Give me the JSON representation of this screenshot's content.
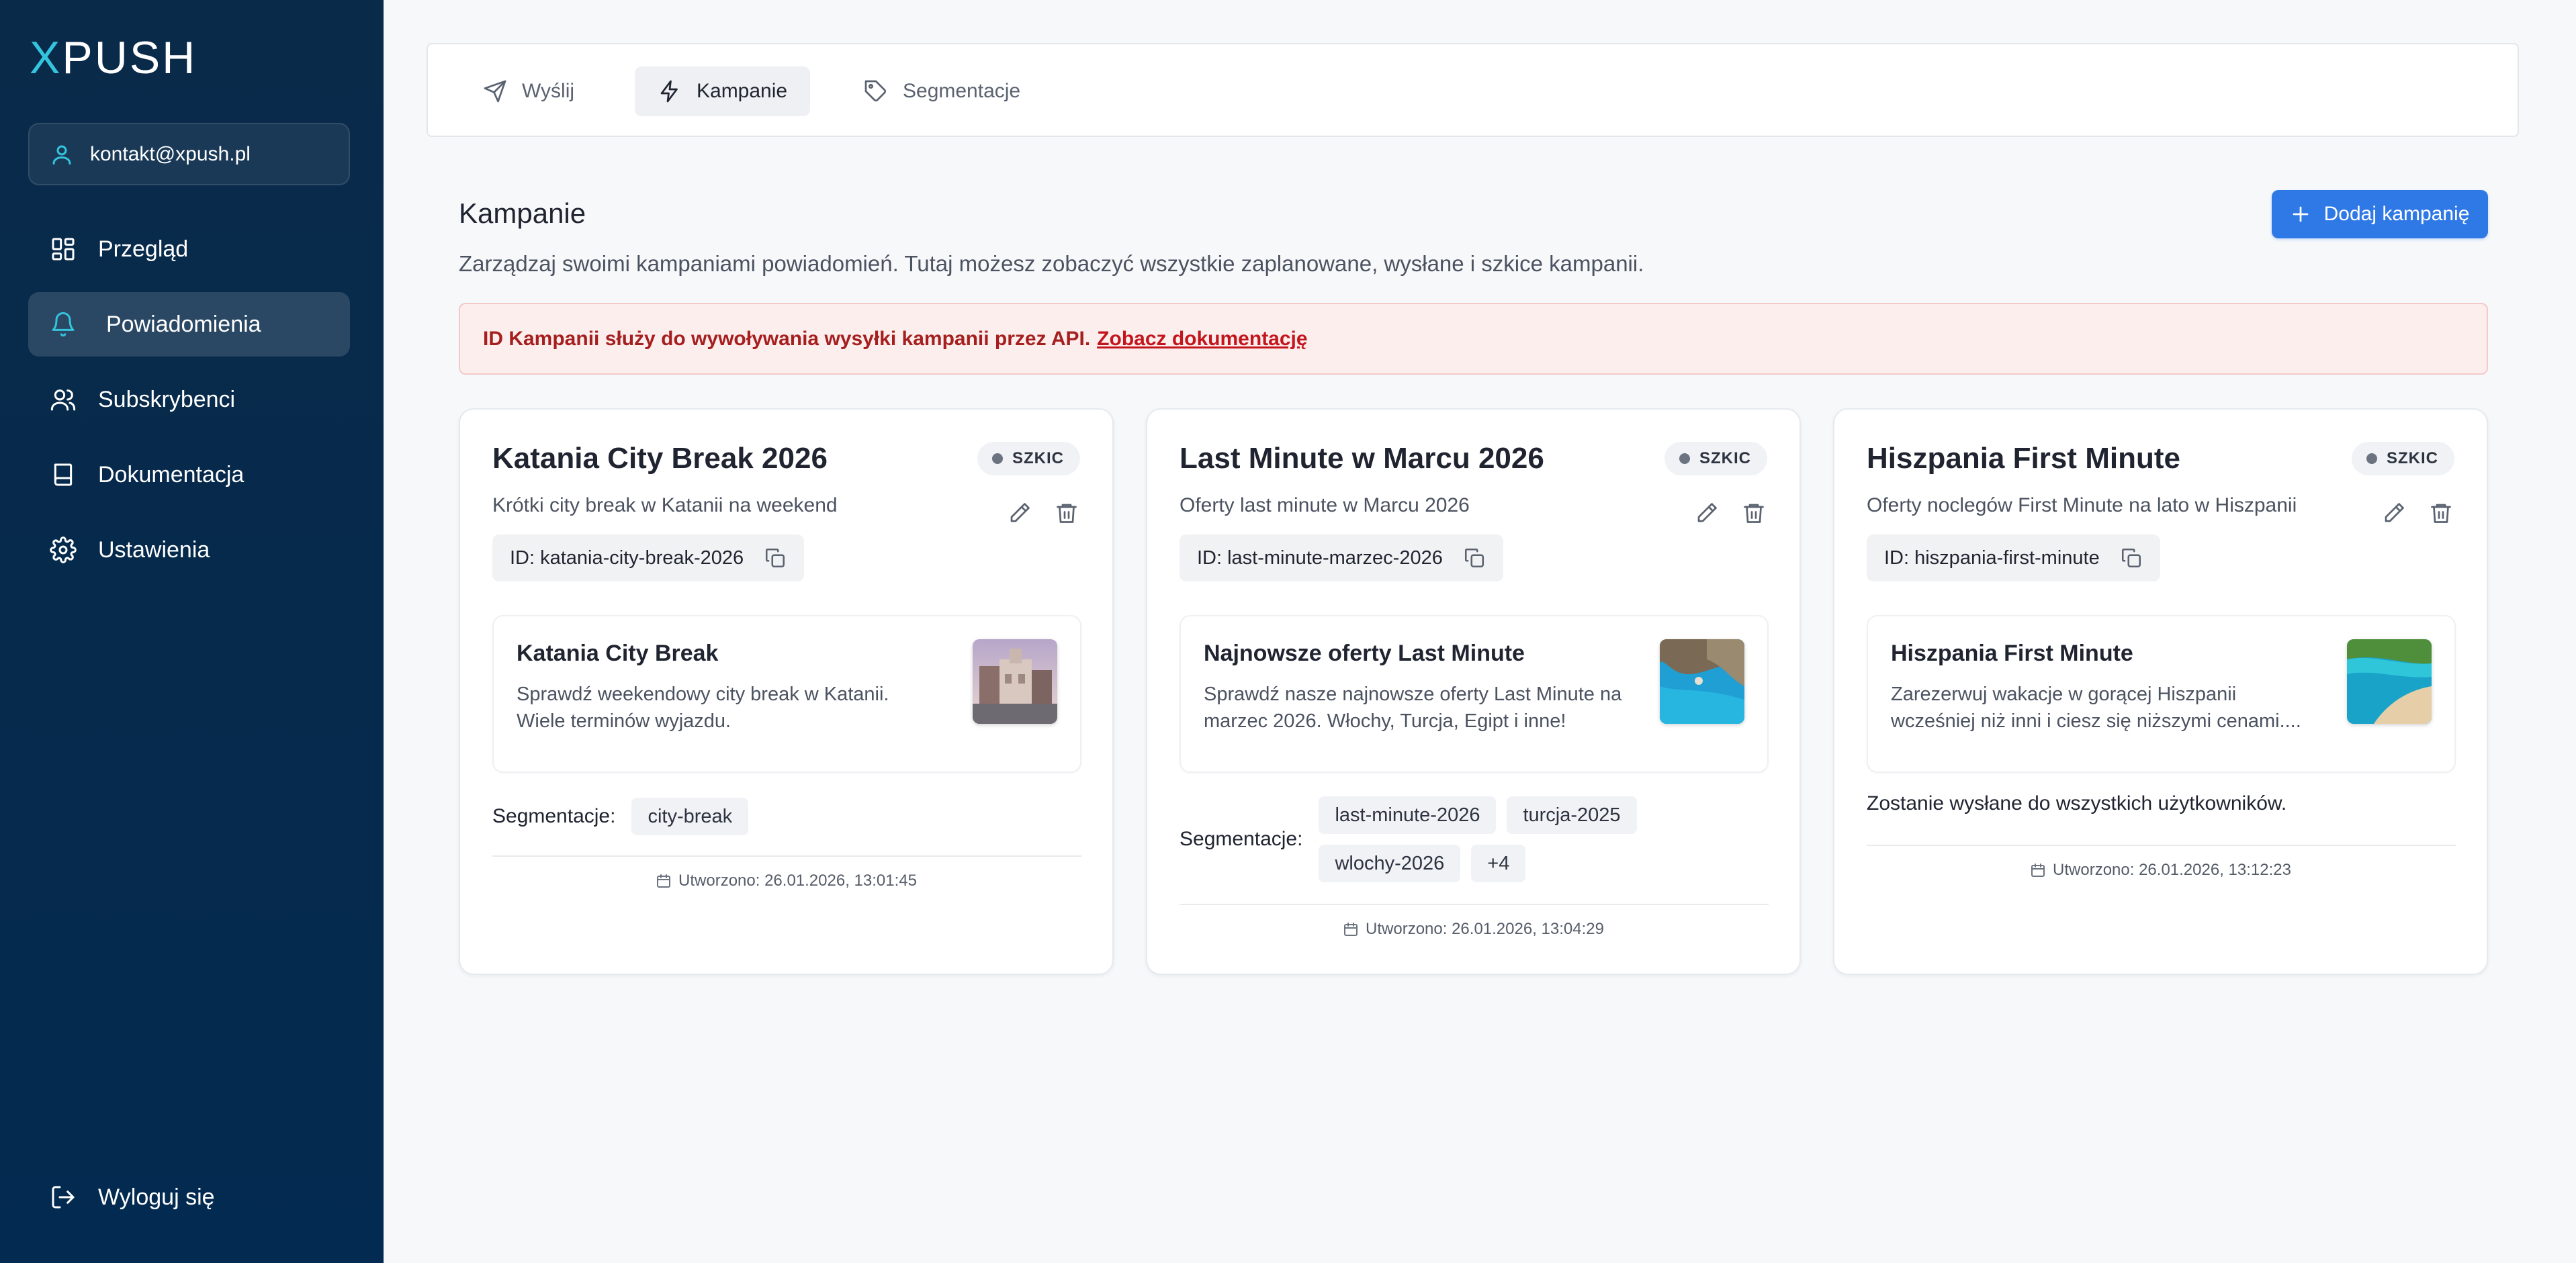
{
  "app": {
    "logo_x": "X",
    "logo_rest": "PUSH"
  },
  "sidebar": {
    "account_email": "kontakt@xpush.pl",
    "items": [
      {
        "label": "Przegląd",
        "icon": "grid-icon"
      },
      {
        "label": "Powiadomienia",
        "icon": "bell-icon",
        "active": true
      },
      {
        "label": "Subskrybenci",
        "icon": "users-icon"
      },
      {
        "label": "Dokumentacja",
        "icon": "book-icon"
      },
      {
        "label": "Ustawienia",
        "icon": "gear-icon"
      }
    ],
    "logout_label": "Wyloguj się"
  },
  "tabs": [
    {
      "label": "Wyślij",
      "icon": "send-icon"
    },
    {
      "label": "Kampanie",
      "icon": "lightning-icon",
      "active": true
    },
    {
      "label": "Segmentacje",
      "icon": "tag-icon"
    }
  ],
  "header": {
    "title": "Kampanie",
    "description": "Zarządzaj swoimi kampaniami powiadomień. Tutaj możesz zobaczyć wszystkie zaplanowane, wysłane i szkice kampanii.",
    "add_button": "Dodaj kampanię"
  },
  "alert": {
    "text": "ID Kampanii służy do wywoływania wysyłki kampanii przez API.",
    "link": "Zobacz dokumentację"
  },
  "cards": [
    {
      "title": "Katania City Break 2026",
      "status": "SZKIC",
      "subtitle": "Krótki city break w Katanii na weekend",
      "id_label": "ID: katania-city-break-2026",
      "preview_title": "Katania City Break",
      "preview_line1": "Sprawdź weekendowy city break w Katanii.",
      "preview_line2": "Wiele terminów wyjazdu.",
      "segments_label": "Segmentacje:",
      "segments": [
        "city-break"
      ],
      "created": "Utworzono: 26.01.2026, 13:01:45"
    },
    {
      "title": "Last Minute w Marcu 2026",
      "status": "SZKIC",
      "subtitle": "Oferty last minute w Marcu 2026",
      "id_label": "ID: last-minute-marzec-2026",
      "preview_title": "Najnowsze oferty Last Minute",
      "preview_line1": "Sprawdź nasze najnowsze oferty Last Minute na",
      "preview_line2": "marzec 2026. Włochy, Turcja, Egipt i inne!",
      "segments_label": "Segmentacje:",
      "segments": [
        "last-minute-2026",
        "turcja-2025",
        "wlochy-2026",
        "+4"
      ],
      "created": "Utworzono: 26.01.2026, 13:04:29"
    },
    {
      "title": "Hiszpania First Minute",
      "status": "SZKIC",
      "subtitle": "Oferty noclegów First Minute na lato w Hiszpanii",
      "id_label": "ID: hiszpania-first-minute",
      "preview_title": "Hiszpania First Minute",
      "preview_line1": "Zarezerwuj wakacje w gorącej Hiszpanii",
      "preview_line2": "wcześniej niż inni i ciesz się niższymi cenami....",
      "all_users_text": "Zostanie wysłane do wszystkich użytkowników.",
      "created": "Utworzono: 26.01.2026, 13:12:23"
    }
  ],
  "colors": {
    "sidebar": "#062a4c",
    "accent": "#35c4dd",
    "primary": "#2f79e6",
    "alert_bg": "#fdeeee",
    "alert_text": "#a51f1f"
  }
}
